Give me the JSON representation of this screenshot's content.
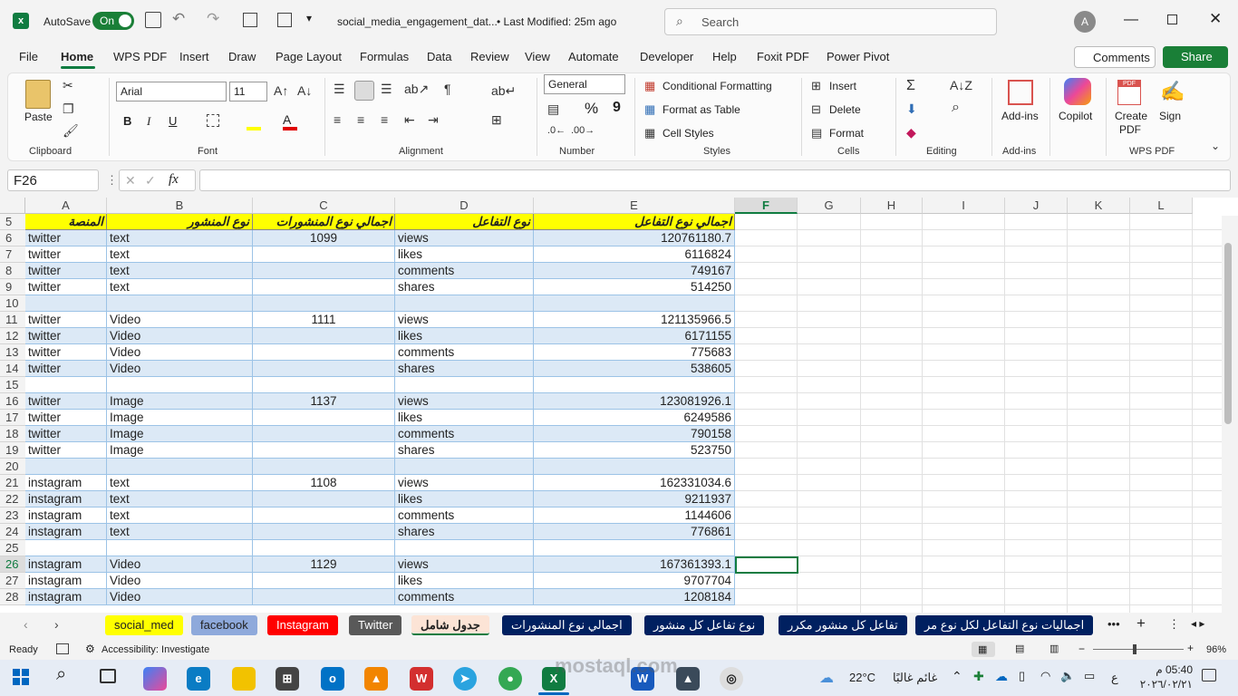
{
  "titlebar": {
    "autosave": "AutoSave",
    "toggle": "On",
    "filename": "social_media_engagement_dat...",
    "modified": "• Last Modified: 25m ago",
    "search": "Search",
    "avatar": "A"
  },
  "menu": [
    "File",
    "Home",
    "WPS PDF",
    "Insert",
    "Draw",
    "Page Layout",
    "Formulas",
    "Data",
    "Review",
    "View",
    "Automate",
    "Developer",
    "Help",
    "Foxit PDF",
    "Power Pivot"
  ],
  "menu_right": {
    "comments": "Comments",
    "share": "Share"
  },
  "ribbon": {
    "clipboard": {
      "paste": "Paste",
      "label": "Clipboard"
    },
    "font": {
      "name": "Arial",
      "size": "11",
      "bold": "B",
      "italic": "I",
      "underline": "U",
      "label": "Font"
    },
    "alignment": {
      "label": "Alignment"
    },
    "number": {
      "format": "General",
      "percent": "%",
      "comma": "9",
      "label": "Number"
    },
    "styles": {
      "conditional": "Conditional Formatting",
      "table": "Format as Table",
      "cell": "Cell Styles",
      "label": "Styles"
    },
    "cells": {
      "insert": "Insert",
      "delete": "Delete",
      "format": "Format",
      "label": "Cells"
    },
    "editing": {
      "label": "Editing"
    },
    "addins": {
      "btn": "Add-ins",
      "label": "Add-ins"
    },
    "copilot": "Copilot",
    "wps": {
      "create": "Create PDF",
      "sign": "Sign",
      "label": "WPS PDF"
    }
  },
  "formula": {
    "namebox": "F26",
    "fx": "fx",
    "value": ""
  },
  "columns": [
    "A",
    "B",
    "C",
    "D",
    "E",
    "F",
    "G",
    "H",
    "I",
    "J",
    "K",
    "L"
  ],
  "header_row": {
    "num": "5",
    "a": "المنصة",
    "b": "نوع المنشور",
    "c": "اجمالي نوع المنشورات",
    "d": "نوع التفاعل",
    "e": "اجمالي نوع التفاعل"
  },
  "rows": [
    {
      "n": "6",
      "a": "twitter",
      "b": "text",
      "c": "1099",
      "d": "views",
      "e": "120761180.7"
    },
    {
      "n": "7",
      "a": "twitter",
      "b": "text",
      "c": "",
      "d": "likes",
      "e": "6116824"
    },
    {
      "n": "8",
      "a": "twitter",
      "b": "text",
      "c": "",
      "d": "comments",
      "e": "749167"
    },
    {
      "n": "9",
      "a": "twitter",
      "b": "text",
      "c": "",
      "d": "shares",
      "e": "514250"
    },
    {
      "n": "10",
      "a": "",
      "b": "",
      "c": "",
      "d": "",
      "e": ""
    },
    {
      "n": "11",
      "a": "twitter",
      "b": "Video",
      "c": "1111",
      "d": "views",
      "e": "121135966.5"
    },
    {
      "n": "12",
      "a": "twitter",
      "b": "Video",
      "c": "",
      "d": "likes",
      "e": "6171155"
    },
    {
      "n": "13",
      "a": "twitter",
      "b": "Video",
      "c": "",
      "d": "comments",
      "e": "775683"
    },
    {
      "n": "14",
      "a": "twitter",
      "b": "Video",
      "c": "",
      "d": "shares",
      "e": "538605"
    },
    {
      "n": "15",
      "a": "",
      "b": "",
      "c": "",
      "d": "",
      "e": ""
    },
    {
      "n": "16",
      "a": "twitter",
      "b": "Image",
      "c": "1137",
      "d": "views",
      "e": "123081926.1"
    },
    {
      "n": "17",
      "a": "twitter",
      "b": "Image",
      "c": "",
      "d": "likes",
      "e": "6249586"
    },
    {
      "n": "18",
      "a": "twitter",
      "b": "Image",
      "c": "",
      "d": "comments",
      "e": "790158"
    },
    {
      "n": "19",
      "a": "twitter",
      "b": "Image",
      "c": "",
      "d": "shares",
      "e": "523750"
    },
    {
      "n": "20",
      "a": "",
      "b": "",
      "c": "",
      "d": "",
      "e": ""
    },
    {
      "n": "21",
      "a": "instagram",
      "b": "text",
      "c": "1108",
      "d": "views",
      "e": "162331034.6"
    },
    {
      "n": "22",
      "a": "instagram",
      "b": "text",
      "c": "",
      "d": "likes",
      "e": "9211937"
    },
    {
      "n": "23",
      "a": "instagram",
      "b": "text",
      "c": "",
      "d": "comments",
      "e": "1144606"
    },
    {
      "n": "24",
      "a": "instagram",
      "b": "text",
      "c": "",
      "d": "shares",
      "e": "776861"
    },
    {
      "n": "25",
      "a": "",
      "b": "",
      "c": "",
      "d": "",
      "e": ""
    },
    {
      "n": "26",
      "a": "instagram",
      "b": "Video",
      "c": "1129",
      "d": "views",
      "e": "167361393.1"
    },
    {
      "n": "27",
      "a": "instagram",
      "b": "Video",
      "c": "",
      "d": "likes",
      "e": "9707704"
    },
    {
      "n": "28",
      "a": "instagram",
      "b": "Video",
      "c": "",
      "d": "comments",
      "e": "1208184"
    }
  ],
  "sheet_tabs": [
    {
      "label": "social_med",
      "bg": "#ffff00",
      "fg": "#222222"
    },
    {
      "label": "facebook",
      "bg": "#8ea9db",
      "fg": "#222222"
    },
    {
      "label": "Instagram",
      "bg": "#ff0000",
      "fg": "#ffffff"
    },
    {
      "label": "Twitter",
      "bg": "#595959",
      "fg": "#ffffff"
    },
    {
      "label": "جدول شامل",
      "bg": "#fce4d6",
      "fg": "#222222"
    },
    {
      "label": "اجمالي نوع المنشورات",
      "bg": "#002060",
      "fg": "#ffffff"
    },
    {
      "label": "نوع تفاعل كل منشور",
      "bg": "#002060",
      "fg": "#ffffff"
    },
    {
      "label": "تفاعل كل منشور مكرر",
      "bg": "#002060",
      "fg": "#ffffff"
    },
    {
      "label": "اجماليات نوع التفاعل لكل نوع مر",
      "bg": "#002060",
      "fg": "#ffffff"
    }
  ],
  "status": {
    "ready": "Ready",
    "accessibility": "Accessibility: Investigate",
    "zoom": "96%"
  },
  "taskbar": {
    "weather": "22°C",
    "weather_text": "غائم غالبًا",
    "lang": "ع",
    "time": "05:40 م",
    "date": "٢٠٢٦/٠٢/٢١",
    "watermark": "mostaql.com"
  }
}
